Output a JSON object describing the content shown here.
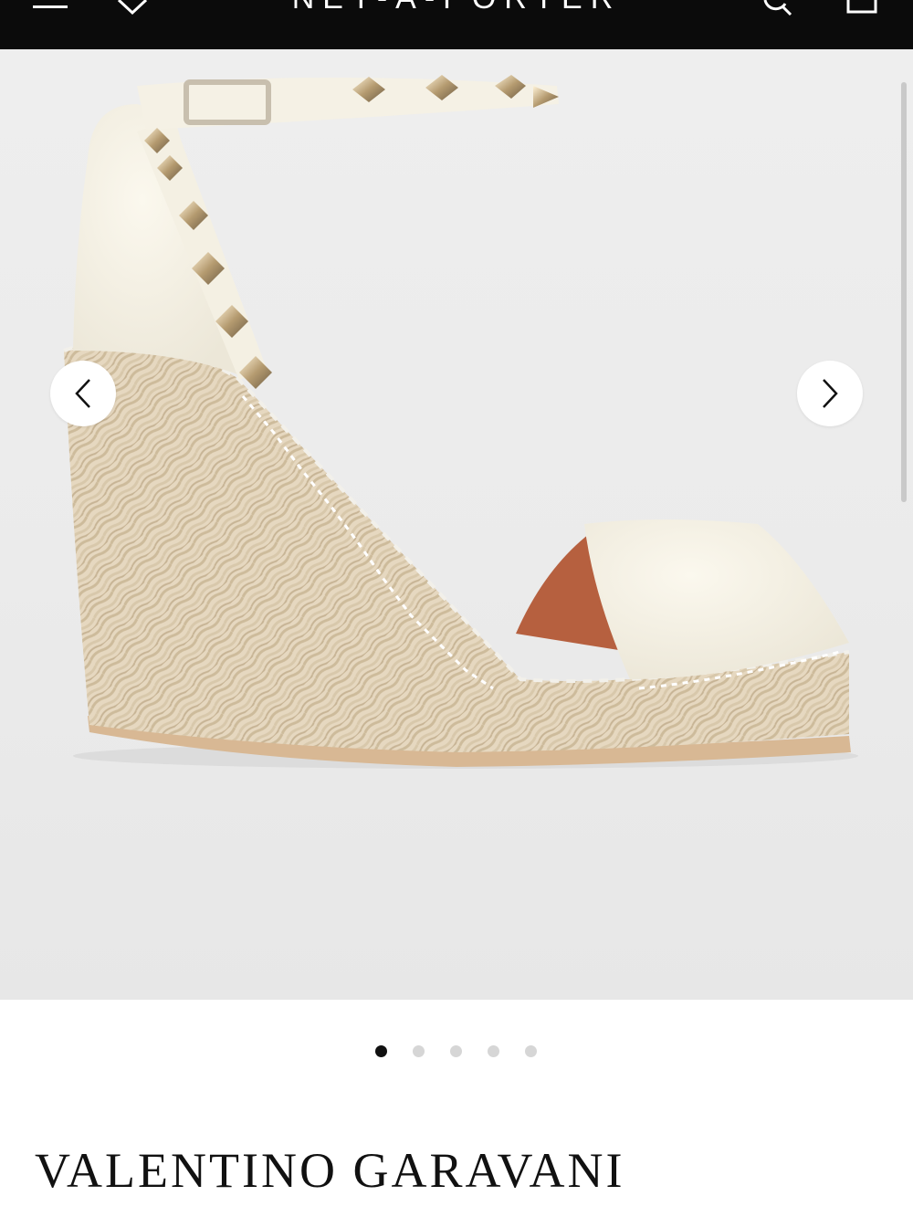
{
  "header": {
    "brand": "NET-A-PORTER",
    "icons": [
      "menu-icon",
      "heart-icon",
      "search-icon",
      "bag-icon"
    ]
  },
  "gallery": {
    "image_subject": "cream leather studded espadrille wedge sandal",
    "prev_icon": "chevron-left-icon",
    "next_icon": "chevron-right-icon",
    "slide_count": 5,
    "active_slide": 1
  },
  "product": {
    "designer": "VALENTINO GARAVANI"
  },
  "colors": {
    "header_bg": "#0b0b0b",
    "gallery_bg": "#ececec",
    "dot_active": "#111111",
    "dot_inactive": "#d6d6d6"
  }
}
